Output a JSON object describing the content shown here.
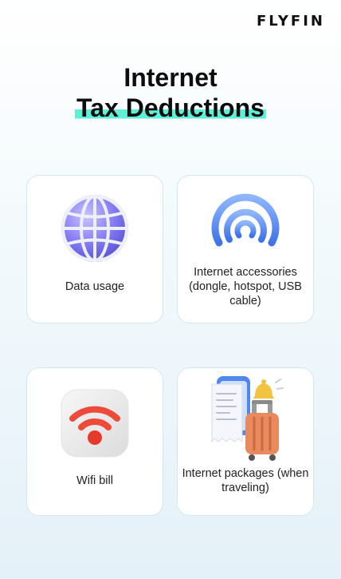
{
  "brand": {
    "logo_text": "FLYFIN"
  },
  "header": {
    "title_line1": "Internet",
    "title_line2": "Tax Deductions"
  },
  "cards": [
    {
      "label": "Data usage",
      "icon": "globe-icon"
    },
    {
      "label": "Internet accessories (dongle, hotspot, USB cable)",
      "icon": "hotspot-signal-icon"
    },
    {
      "label": "Wifi bill",
      "icon": "wifi-icon"
    },
    {
      "label": "Internet packages (when traveling)",
      "icon": "travel-luggage-icon"
    }
  ],
  "colors": {
    "highlight": "#5ef0d6",
    "globe": "#7b74f0",
    "signal": "#5a8ef5",
    "wifi": "#ee4a3a",
    "luggage": "#e98a5e",
    "card_border": "#cfeaf3"
  }
}
